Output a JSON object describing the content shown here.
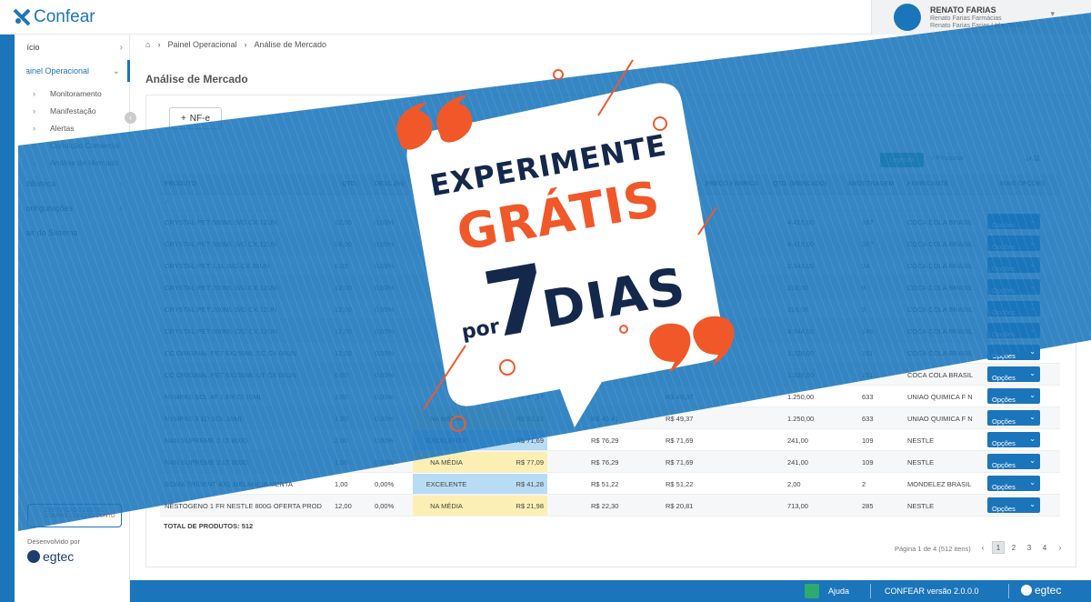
{
  "app": {
    "brand": "Confear"
  },
  "user": {
    "name": "RENATO FARIAS",
    "line1": "Renato Farias Farmácias",
    "line2": "Renato Farias Farias Ltda. RRVVS"
  },
  "sidebar": {
    "items": [
      {
        "label": "Início"
      },
      {
        "label": "Painel Operacional"
      },
      {
        "label": "Biblioteca"
      },
      {
        "label": "Configurações"
      },
      {
        "label": "Sair do Sistema"
      }
    ],
    "subitems": [
      {
        "label": "Monitoramento"
      },
      {
        "label": "Manifestação"
      },
      {
        "label": "Alertas"
      },
      {
        "label": "Condição Comercial"
      },
      {
        "label": "Análise de Mercado"
      }
    ],
    "cert": {
      "title": "CERTIFICADO DIGITAL",
      "sub": "COMPRE COM DESCONTO"
    },
    "developed_by": "Desenvolvido por",
    "dev_brand": "egtec"
  },
  "breadcrumb": {
    "item1": "Painel Operacional",
    "item2": "Análise de Mercado"
  },
  "page": {
    "title": "Análise de Mercado",
    "nfe_label": "NF-e",
    "legend_label": "Legenda",
    "search_label": "Pesquisar"
  },
  "grid": {
    "headers": {
      "produto": "PRODUTO",
      "qtd": "QTD.",
      "desc": "DESC.(%)",
      "preco_fabrica": "PREÇO FÁBRICA",
      "qtd_mercado": "QTD. (MERCADO)",
      "amostragem": "AMOSTRAGEM",
      "fabricante": "FABRICANTE",
      "mais": "MAIS OPÇÕES"
    },
    "rows": [
      {
        "produto": "CRYSTAL PET 500ML S/G CX 12UN",
        "qtd": "12,00",
        "desc": "0,00%",
        "cat": "",
        "price": "",
        "pf": "",
        "pm": "",
        "qm": "4.416,00",
        "amost": "167",
        "fab": "COCA COLA BRASIL"
      },
      {
        "produto": "CRYSTAL PET 500ML S/G CX 12UN",
        "qtd": "24,00",
        "desc": "0,00%",
        "cat": "",
        "price": "",
        "pf": "",
        "pm": "",
        "qm": "4.416,00",
        "amost": "167",
        "fab": "COCA COLA BRASIL"
      },
      {
        "produto": "CRYSTAL PET 1,5L S/G CX 06UN",
        "qtd": "6,00",
        "desc": "0,00%",
        "cat": "",
        "price": "",
        "pf": "",
        "pm": "",
        "qm": "2.542,00",
        "amost": "34",
        "fab": "COCA COLA BRASIL"
      },
      {
        "produto": "CRYSTAL PET 200ML S/G CX 12UN",
        "qtd": "12,00",
        "desc": "0,00%",
        "cat": "",
        "price": "",
        "pf": "",
        "pm": "",
        "qm": "216,00",
        "amost": "9",
        "fab": "COCA COLA BRASIL"
      },
      {
        "produto": "CRYSTAL PET 200ML S/G CX 12UN",
        "qtd": "12,00",
        "desc": "0,00%",
        "cat": "",
        "price": "",
        "pf": "",
        "pm": "",
        "qm": "216,00",
        "amost": "9",
        "fab": "COCA COLA BRASIL"
      },
      {
        "produto": "CRYSTAL PET 500ML C/G CX 12UN",
        "qtd": "12,00",
        "desc": "0,00%",
        "cat": "",
        "price": "",
        "pf": "",
        "pm": "",
        "qm": "4.944,00",
        "amost": "146",
        "fab": "COCA COLA BRASIL"
      },
      {
        "produto": "CC ORIGINAL PET 6X250ML SC CX 06UN",
        "qtd": "12,00",
        "desc": "0,00%",
        "cat": "",
        "price": "",
        "pf": "",
        "pm": "",
        "qm": "1.328,00",
        "amost": "151",
        "fab": "COCA COLA BRASIL"
      },
      {
        "produto": "CC ORIGINAL PET 6X250ML UT CX 06UN",
        "qtd": "6,00",
        "desc": "0,00%",
        "cat": "",
        "price": "",
        "pf": "",
        "pm": "",
        "qm": "1.328,00",
        "amost": "151",
        "fab": "COCA COLA BRASIL"
      },
      {
        "produto": "NYMPAS SOL 4F 1 FR C/ 10ML",
        "qtd": "2,00",
        "desc": "0,00%",
        "cat": "",
        "price": "R$ 47,37",
        "pf": "",
        "pm": "R$ 49,37",
        "qm": "1.250,00",
        "amost": "633",
        "fab": "UNIAO QUIMICA F N"
      },
      {
        "produto": "NYMPAS 3 1D SOL 10ML",
        "qtd": "1,00",
        "desc": "0,00%",
        "cat": "NA MÉDIA",
        "price": "R$ 53,32",
        "pf": "R$ 49,41",
        "pm": "R$ 49,37",
        "qm": "1.250,00",
        "amost": "633",
        "fab": "UNIAO QUIMICA F N"
      },
      {
        "produto": "NAN SUPREME 2 LT 800G",
        "qtd": "2,00",
        "desc": "0,00%",
        "cat": "EXCELENTE",
        "price": "R$ 71,69",
        "pf": "R$ 76,29",
        "pm": "R$ 71,69",
        "qm": "241,00",
        "amost": "109",
        "fab": "NESTLE"
      },
      {
        "produto": "NAN SUPREME 2 LT 800G",
        "qtd": "1,00",
        "desc": "0,00%",
        "cat": "NA MÉDIA",
        "price": "R$ 77,09",
        "pf": "R$ 76,29",
        "pm": "R$ 71,69",
        "qm": "241,00",
        "amost": "109",
        "fab": "NESTLE"
      },
      {
        "produto": "GOMA TRIDENT 40G MELANCIA MENTA",
        "qtd": "1,00",
        "desc": "0,00%",
        "cat": "EXCELENTE",
        "price": "R$ 41,28",
        "pf": "R$ 51,22",
        "pm": "R$ 51,22",
        "qm": "2,00",
        "amost": "2",
        "fab": "MONDELEZ BRASIL"
      },
      {
        "produto": "NESTOGENO 1 FR NESTLE 800G OFERTA PROD",
        "qtd": "12,00",
        "desc": "0,00%",
        "cat": "NA MÉDIA",
        "price": "R$ 21,98",
        "pf": "R$ 22,30",
        "pm": "R$ 20,81",
        "qm": "713,00",
        "amost": "285",
        "fab": "NESTLE"
      }
    ],
    "options_label": "Opções",
    "total": "TOTAL DE PRODUTOS: 512"
  },
  "pager": {
    "info": "Página 1 de 4 (512 itens)",
    "pages": [
      "1",
      "2",
      "3",
      "4"
    ]
  },
  "footer": {
    "help": "Ajuda",
    "version": "CONFEAR versão 2.0.0.0",
    "brand": "egtec"
  },
  "promo": {
    "line1": "EXPERIMENTE",
    "line2": "GRÁTIS",
    "line3": "por",
    "line4": "7",
    "line5": "DIAS"
  },
  "colors": {
    "primary": "#1b75bb",
    "band": "#1b75bb",
    "accent": "#f0582a",
    "navy": "#14284b",
    "good": "#b9dcf5",
    "mid": "#fcefb4"
  }
}
